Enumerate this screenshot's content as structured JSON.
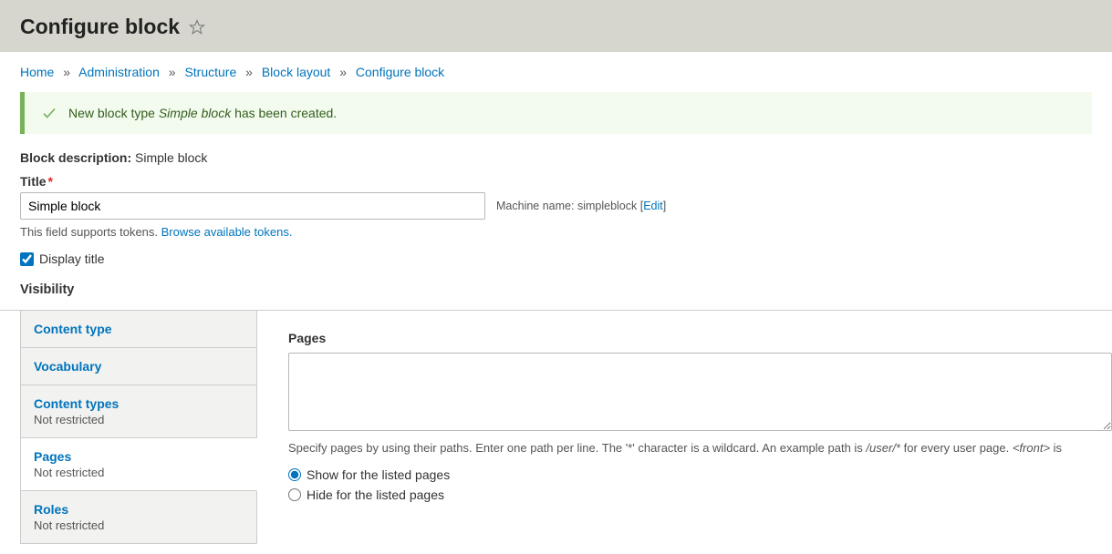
{
  "page_title": "Configure block",
  "breadcrumb": {
    "items": [
      "Home",
      "Administration",
      "Structure",
      "Block layout",
      "Configure block"
    ]
  },
  "status_message": {
    "prefix": "New block type ",
    "em": "Simple block",
    "suffix": " has been created."
  },
  "block_description": {
    "label": "Block description:",
    "value": "Simple block"
  },
  "title_field": {
    "label": "Title",
    "value": "Simple block",
    "machine_label": "Machine name:",
    "machine_value": "simpleblock",
    "edit_label": "Edit",
    "desc_prefix": "This field supports tokens. ",
    "desc_link": "Browse available tokens."
  },
  "display_title": {
    "label": "Display title",
    "checked": true
  },
  "visibility": {
    "heading": "Visibility",
    "tabs": [
      {
        "title": "Content type",
        "sub": ""
      },
      {
        "title": "Vocabulary",
        "sub": ""
      },
      {
        "title": "Content types",
        "sub": "Not restricted"
      },
      {
        "title": "Pages",
        "sub": "Not restricted"
      },
      {
        "title": "Roles",
        "sub": "Not restricted"
      }
    ],
    "active_tab_index": 3,
    "pages_pane": {
      "label": "Pages",
      "textarea_value": "",
      "description_plain": "Specify pages by using their paths. Enter one path per line. The '*' character is a wildcard. An example path is ",
      "description_em1": "/user/*",
      "description_mid": " for every user page. ",
      "description_em2": "<front>",
      "description_tail": " is",
      "radios": [
        {
          "label": "Show for the listed pages",
          "checked": true
        },
        {
          "label": "Hide for the listed pages",
          "checked": false
        }
      ]
    }
  }
}
